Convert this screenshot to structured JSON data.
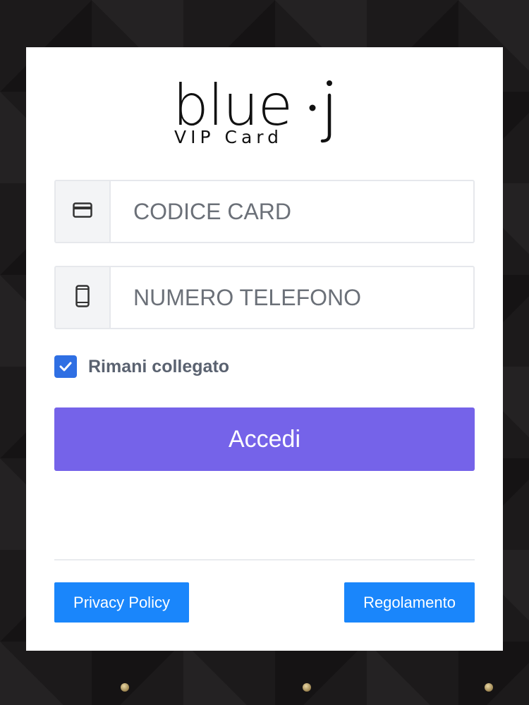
{
  "logo": {
    "brand": "blue",
    "suffix": "j",
    "tagline": "VIP Card"
  },
  "form": {
    "card_code": {
      "placeholder": "CODICE CARD",
      "value": "",
      "icon": "credit-card-icon"
    },
    "phone": {
      "placeholder": "NUMERO TELEFONO",
      "value": "",
      "icon": "mobile-phone-icon"
    },
    "remember": {
      "label": "Rimani collegato",
      "checked": true
    },
    "submit_label": "Accedi"
  },
  "footer": {
    "privacy_label": "Privacy Policy",
    "rules_label": "Regolamento"
  },
  "colors": {
    "submit": "#7563e9",
    "footer_buttons": "#1a86fb",
    "checkbox": "#2f6fe3"
  }
}
